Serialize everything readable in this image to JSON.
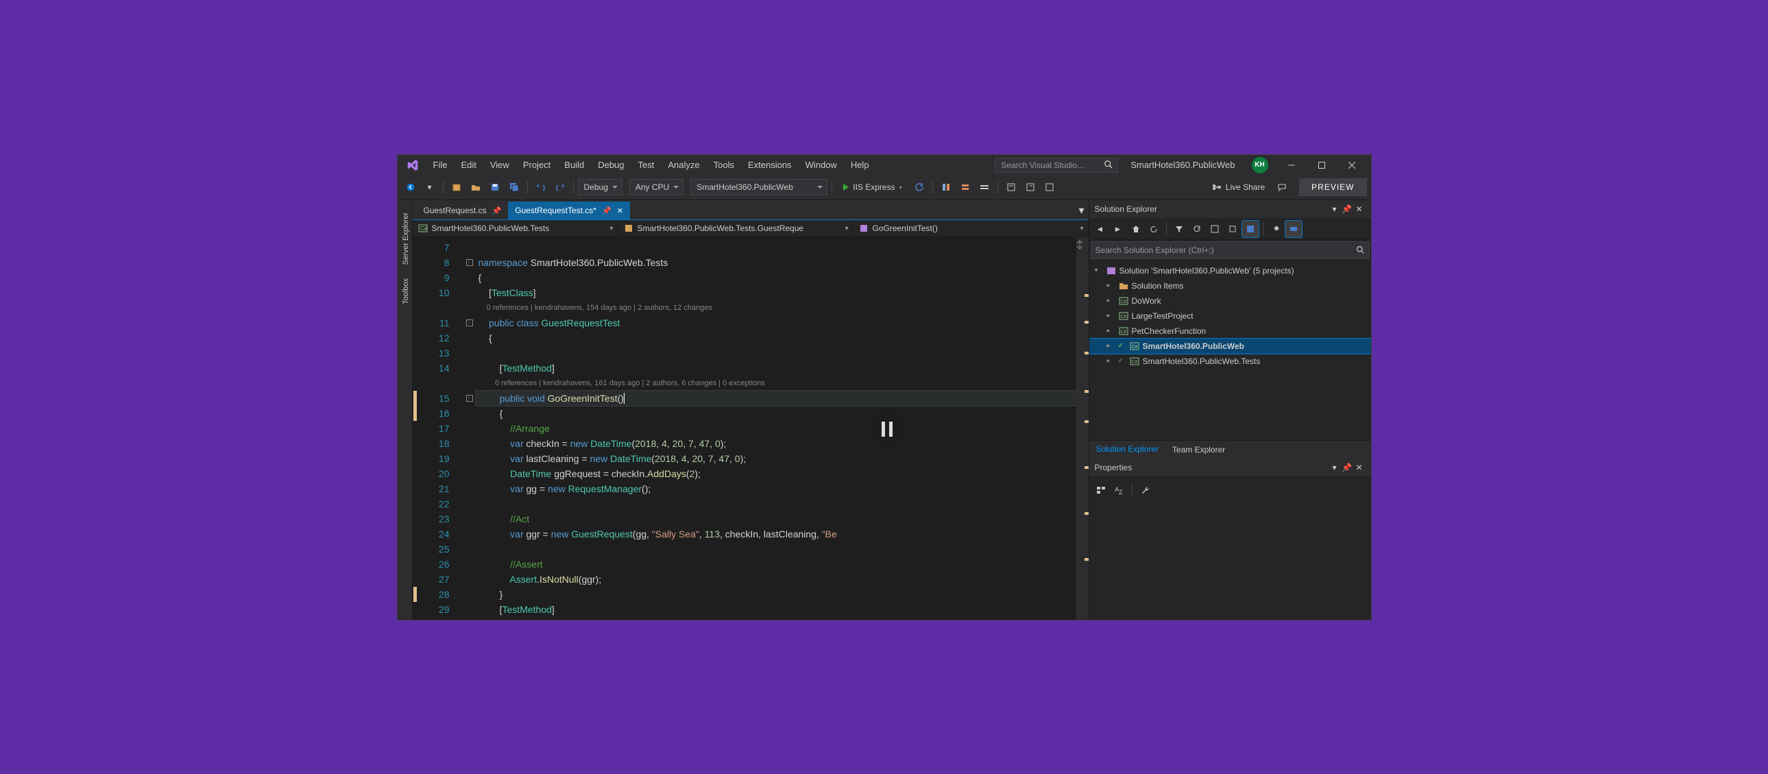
{
  "title_bar": {
    "menu": [
      "File",
      "Edit",
      "View",
      "Project",
      "Build",
      "Debug",
      "Test",
      "Analyze",
      "Tools",
      "Extensions",
      "Window",
      "Help"
    ],
    "search_placeholder": "Search Visual Studio...",
    "solution_title": "SmartHotel360.PublicWeb",
    "user_initials": "KH"
  },
  "toolbar": {
    "config": "Debug",
    "platform": "Any CPU",
    "startup": "SmartHotel360.PublicWeb",
    "run_label": "IIS Express",
    "live_share": "Live Share",
    "preview": "PREVIEW"
  },
  "side_tabs": [
    "Server Explorer",
    "Toolbox"
  ],
  "doc_tabs": [
    {
      "label": "GuestRequest.cs",
      "active": false,
      "pinned": true
    },
    {
      "label": "GuestRequestTest.cs*",
      "active": true,
      "pinned": true
    }
  ],
  "nav_bar": {
    "project": "SmartHotel360.PublicWeb.Tests",
    "class": "SmartHotel360.PublicWeb.Tests.GuestReque",
    "method": "GoGreenInitTest()"
  },
  "code": {
    "lines": [
      {
        "n": 7,
        "segs": []
      },
      {
        "n": 8,
        "fold": true,
        "segs": [
          [
            "kw",
            "namespace"
          ],
          [
            "ns",
            " SmartHotel360.PublicWeb.Tests"
          ]
        ]
      },
      {
        "n": 9,
        "segs": [
          [
            "",
            "{"
          ]
        ]
      },
      {
        "n": 10,
        "segs": [
          [
            "",
            "    ["
          ],
          [
            "type",
            "TestClass"
          ],
          [
            "",
            "]"
          ]
        ]
      },
      {
        "n": null,
        "codelens": true,
        "text": "    0 references | kendrahavens, 154 days ago | 2 authors, 12 changes"
      },
      {
        "n": 11,
        "fold": true,
        "segs": [
          [
            "kw",
            "    public class "
          ],
          [
            "type",
            "GuestRequestTest"
          ]
        ]
      },
      {
        "n": 12,
        "segs": [
          [
            "",
            "    {"
          ]
        ]
      },
      {
        "n": 13,
        "segs": []
      },
      {
        "n": 14,
        "segs": [
          [
            "",
            "        ["
          ],
          [
            "type",
            "TestMethod"
          ],
          [
            "",
            "]"
          ]
        ]
      },
      {
        "n": null,
        "codelens": true,
        "text": "        0 references | kendrahavens, 161 days ago | 2 authors, 6 changes | 0 exceptions"
      },
      {
        "n": 15,
        "marker": "yellow",
        "fold": true,
        "current": true,
        "segs": [
          [
            "kw",
            "        public void "
          ],
          [
            "method",
            "GoGreenInitTest"
          ],
          [
            "",
            "()"
          ]
        ]
      },
      {
        "n": 16,
        "marker": "yellow",
        "segs": [
          [
            "",
            "        {"
          ]
        ]
      },
      {
        "n": 17,
        "segs": [
          [
            "comment",
            "            //Arrange"
          ]
        ]
      },
      {
        "n": 18,
        "segs": [
          [
            "kw",
            "            var"
          ],
          [
            "",
            " checkIn = "
          ],
          [
            "kw",
            "new"
          ],
          [
            "",
            " "
          ],
          [
            "type",
            "DateTime"
          ],
          [
            "",
            "("
          ],
          [
            "num",
            "2018"
          ],
          [
            "",
            ", "
          ],
          [
            "num",
            "4"
          ],
          [
            "",
            ", "
          ],
          [
            "num",
            "20"
          ],
          [
            "",
            ", "
          ],
          [
            "num",
            "7"
          ],
          [
            "",
            ", "
          ],
          [
            "num",
            "47"
          ],
          [
            "",
            ", "
          ],
          [
            "num",
            "0"
          ],
          [
            "",
            ");"
          ]
        ]
      },
      {
        "n": 19,
        "segs": [
          [
            "kw",
            "            var"
          ],
          [
            "",
            " lastCleaning = "
          ],
          [
            "kw",
            "new"
          ],
          [
            "",
            " "
          ],
          [
            "type",
            "DateTime"
          ],
          [
            "",
            "("
          ],
          [
            "num",
            "2018"
          ],
          [
            "",
            ", "
          ],
          [
            "num",
            "4"
          ],
          [
            "",
            ", "
          ],
          [
            "num",
            "20"
          ],
          [
            "",
            ", "
          ],
          [
            "num",
            "7"
          ],
          [
            "",
            ", "
          ],
          [
            "num",
            "47"
          ],
          [
            "",
            ", "
          ],
          [
            "num",
            "0"
          ],
          [
            "",
            ");"
          ]
        ]
      },
      {
        "n": 20,
        "segs": [
          [
            "type",
            "            DateTime"
          ],
          [
            "",
            " ggRequest = checkIn."
          ],
          [
            "method",
            "AddDays"
          ],
          [
            "",
            "("
          ],
          [
            "num",
            "2"
          ],
          [
            "",
            ");"
          ]
        ]
      },
      {
        "n": 21,
        "segs": [
          [
            "kw",
            "            var"
          ],
          [
            "",
            " gg = "
          ],
          [
            "kw",
            "new"
          ],
          [
            "",
            " "
          ],
          [
            "type",
            "RequestManager"
          ],
          [
            "",
            "();"
          ]
        ]
      },
      {
        "n": 22,
        "segs": []
      },
      {
        "n": 23,
        "segs": [
          [
            "comment",
            "            //Act"
          ]
        ]
      },
      {
        "n": 24,
        "segs": [
          [
            "kw",
            "            var"
          ],
          [
            "",
            " ggr = "
          ],
          [
            "kw",
            "new"
          ],
          [
            "",
            " "
          ],
          [
            "type",
            "GuestRequest"
          ],
          [
            "",
            "(gg, "
          ],
          [
            "str",
            "\"Sally Sea\""
          ],
          [
            "",
            ", "
          ],
          [
            "num",
            "113"
          ],
          [
            "",
            ", checkIn, lastCleaning, "
          ],
          [
            "str",
            "\"Be"
          ]
        ]
      },
      {
        "n": 25,
        "segs": []
      },
      {
        "n": 26,
        "segs": [
          [
            "comment",
            "            //Assert"
          ]
        ]
      },
      {
        "n": 27,
        "segs": [
          [
            "type",
            "            Assert"
          ],
          [
            "",
            "."
          ],
          [
            "method",
            "IsNotNull"
          ],
          [
            "",
            "(ggr);"
          ]
        ]
      },
      {
        "n": 28,
        "marker": "yellow",
        "segs": [
          [
            "",
            "        }"
          ]
        ]
      },
      {
        "n": 29,
        "segs": [
          [
            "",
            "        ["
          ],
          [
            "type",
            "TestMethod"
          ],
          [
            "",
            "]"
          ]
        ]
      }
    ]
  },
  "solution_explorer": {
    "title": "Solution Explorer",
    "search_placeholder": "Search Solution Explorer (Ctrl+;)",
    "root": "Solution 'SmartHotel360.PublicWeb' (5 projects)",
    "items": [
      {
        "label": "Solution Items",
        "icon": "folder",
        "chk": false
      },
      {
        "label": "DoWork",
        "icon": "csproj",
        "chk": false
      },
      {
        "label": "LargeTestProject",
        "icon": "csproj",
        "chk": false
      },
      {
        "label": "PetCheckerFunction",
        "icon": "csproj",
        "chk": false
      },
      {
        "label": "SmartHotel360.PublicWeb",
        "icon": "csproj",
        "chk": true,
        "bold": true,
        "selected": true
      },
      {
        "label": "SmartHotel360.PublicWeb.Tests",
        "icon": "csproj",
        "chk": true
      }
    ],
    "tabs": [
      "Solution Explorer",
      "Team Explorer"
    ]
  },
  "properties": {
    "title": "Properties"
  }
}
